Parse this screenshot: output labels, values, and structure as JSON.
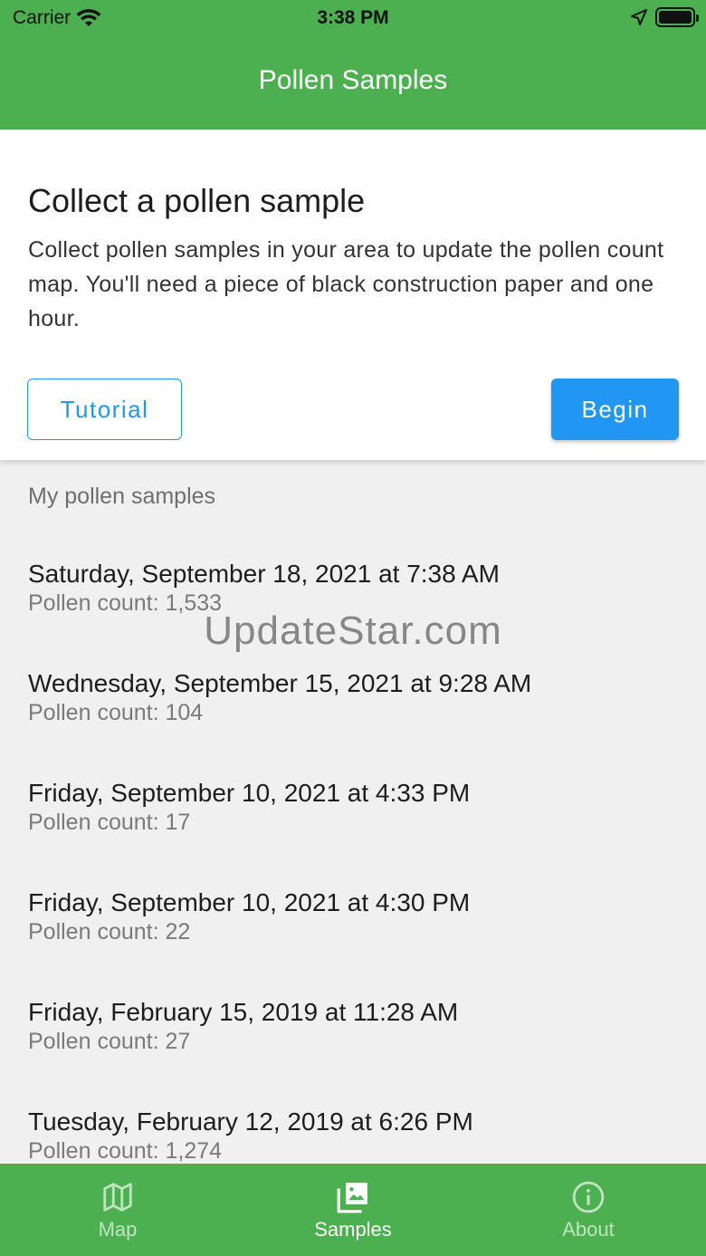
{
  "status_bar": {
    "carrier": "Carrier",
    "time": "3:38 PM"
  },
  "header": {
    "title": "Pollen Samples",
    "color": "#4caf50"
  },
  "card": {
    "title": "Collect a pollen sample",
    "body": "Collect pollen samples in your area to update the pollen count map. You'll need a piece of black construction paper and one hour.",
    "tutorial_label": "Tutorial",
    "begin_label": "Begin",
    "accent_color": "#2196f3"
  },
  "samples": {
    "section_label": "My pollen samples",
    "items": [
      {
        "date": "Saturday, September 18, 2021 at 7:38 AM",
        "count": "Pollen count: 1,533"
      },
      {
        "date": "Wednesday, September 15, 2021 at 9:28 AM",
        "count": "Pollen count: 104"
      },
      {
        "date": "Friday, September 10, 2021 at 4:33 PM",
        "count": "Pollen count: 17"
      },
      {
        "date": "Friday, September 10, 2021 at 4:30 PM",
        "count": "Pollen count: 22"
      },
      {
        "date": "Friday, February 15, 2019 at 11:28 AM",
        "count": "Pollen count: 27"
      },
      {
        "date": "Tuesday, February 12, 2019 at 6:26 PM",
        "count": "Pollen count: 1,274"
      }
    ]
  },
  "watermark": "UpdateStar.com",
  "tabbar": {
    "tabs": [
      {
        "label": "Map",
        "icon": "map-icon"
      },
      {
        "label": "Samples",
        "icon": "photo-library-icon",
        "active": true
      },
      {
        "label": "About",
        "icon": "info-icon"
      }
    ]
  }
}
